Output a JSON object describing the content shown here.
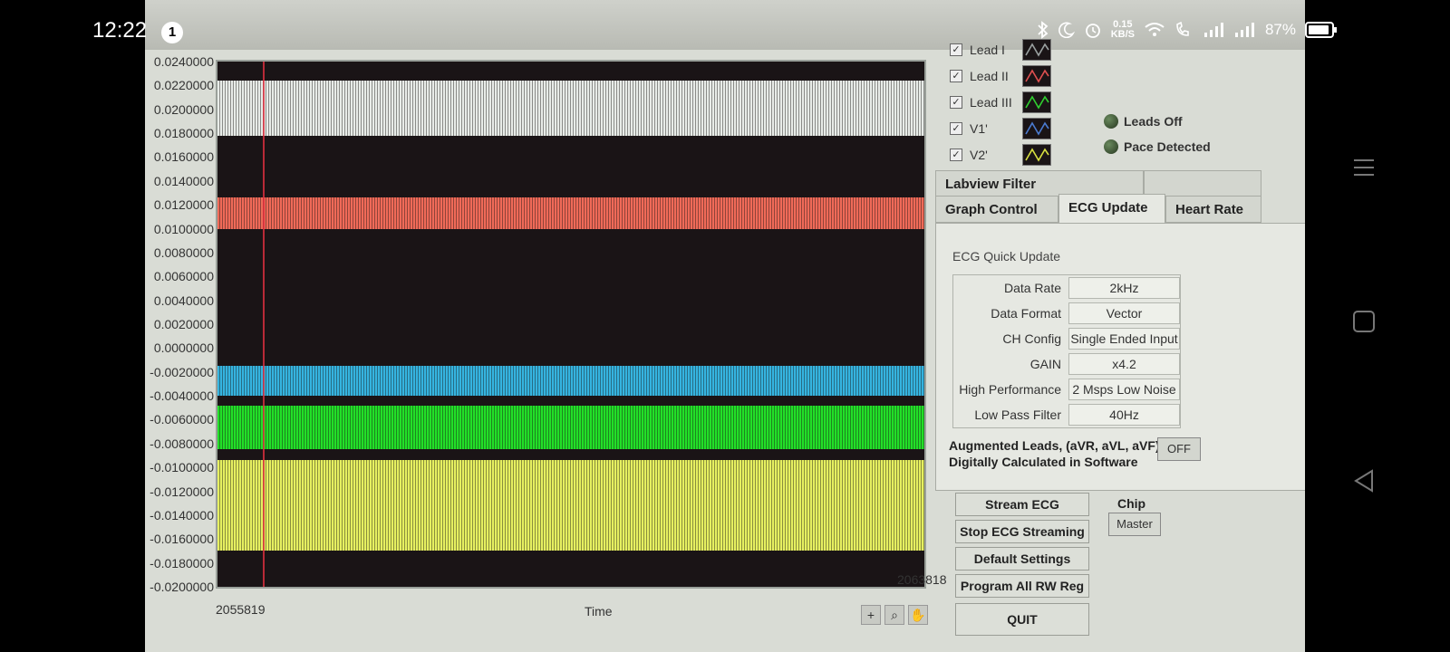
{
  "status": {
    "time": "12:22",
    "notification_count": "1",
    "net_speed_value": "0.15",
    "net_speed_unit": "KB/S",
    "battery": "87%"
  },
  "graph": {
    "y_ticks": [
      "0.0240000",
      "0.0220000",
      "0.0200000",
      "0.0180000",
      "0.0160000",
      "0.0140000",
      "0.0120000",
      "0.0100000",
      "0.0080000",
      "0.0060000",
      "0.0040000",
      "0.0020000",
      "0.0000000",
      "-0.0020000",
      "-0.0040000",
      "-0.0060000",
      "-0.0080000",
      "-0.0100000",
      "-0.0120000",
      "-0.0140000",
      "-0.0160000",
      "-0.0180000",
      "-0.0200000"
    ],
    "x_min": "2055819",
    "x_max": "2063818",
    "x_label": "Time",
    "bands": [
      {
        "name": "Lead I",
        "color": "#e8ece8",
        "y_top": 0.0224,
        "y_bottom": 0.0178
      },
      {
        "name": "Lead II",
        "color": "#f06a58",
        "y_top": 0.0126,
        "y_bottom": 0.01
      },
      {
        "name": "V1'",
        "color": "#35b4e0",
        "y_top": -0.0015,
        "y_bottom": -0.004
      },
      {
        "name": "Lead III",
        "color": "#22e028",
        "y_top": -0.0048,
        "y_bottom": -0.0085
      },
      {
        "name": "V2'",
        "color": "#e6f060",
        "y_top": -0.0094,
        "y_bottom": -0.017
      }
    ],
    "y_range": [
      -0.02,
      0.024
    ]
  },
  "legend": [
    {
      "label": "Lead I",
      "color": "#9aa0a0"
    },
    {
      "label": "Lead II",
      "color": "#e05050"
    },
    {
      "label": "Lead III",
      "color": "#30d030"
    },
    {
      "label": "V1'",
      "color": "#4a7ad0"
    },
    {
      "label": "V2'",
      "color": "#d8e040"
    }
  ],
  "indicators": {
    "leads_off": "Leads Off",
    "pace_detected": "Pace Detected"
  },
  "tabs": {
    "labview_filter": "Labview Filter",
    "graph_control": "Graph Control",
    "ecg_update": "ECG Update",
    "heart_rate": "Heart Rate"
  },
  "ecg_update": {
    "title": "ECG Quick Update",
    "rows": [
      {
        "label": "Data Rate",
        "value": "2kHz"
      },
      {
        "label": "Data Format",
        "value": "Vector"
      },
      {
        "label": "CH Config",
        "value": "Single Ended Input"
      },
      {
        "label": "GAIN",
        "value": "x4.2"
      },
      {
        "label": "High Performance",
        "value": "2 Msps Low Noise"
      },
      {
        "label": "Low Pass Filter",
        "value": "40Hz"
      }
    ],
    "augmented_line1": "Augmented Leads, (aVR, aVL, aVF)",
    "augmented_line2": "Digitally Calculated in Software",
    "augmented_toggle": "OFF"
  },
  "actions": {
    "stream": "Stream ECG",
    "stop": "Stop ECG Streaming",
    "defaults": "Default Settings",
    "program": "Program All RW Reg",
    "quit": "QUIT"
  },
  "chip": {
    "label": "Chip",
    "value": "Master"
  }
}
